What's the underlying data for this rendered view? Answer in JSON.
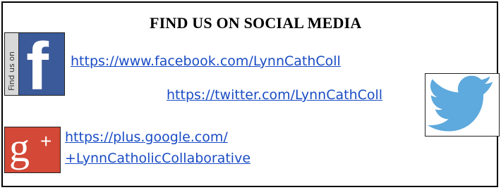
{
  "heading": "FIND US ON SOCIAL MEDIA",
  "links": {
    "facebook": "https://www.facebook.com/LynnCathColl",
    "twitter": "https://twitter.com/LynnCathColl",
    "google_plus_line1": "https://plus.google.com/",
    "google_plus_line2": "+LynnCatholicCollaborative"
  },
  "logos": {
    "facebook": {
      "letter": "f",
      "side_text": "Find us on",
      "icon": "facebook-icon",
      "color": "#3b5a9a"
    },
    "twitter": {
      "icon": "twitter-bird-icon",
      "color": "#5ea9dd"
    },
    "google_plus": {
      "letter": "g",
      "plus": "+",
      "icon": "google-plus-icon",
      "color": "#d34836"
    }
  },
  "colors": {
    "link": "#1a4cc4",
    "border": "#000000"
  }
}
